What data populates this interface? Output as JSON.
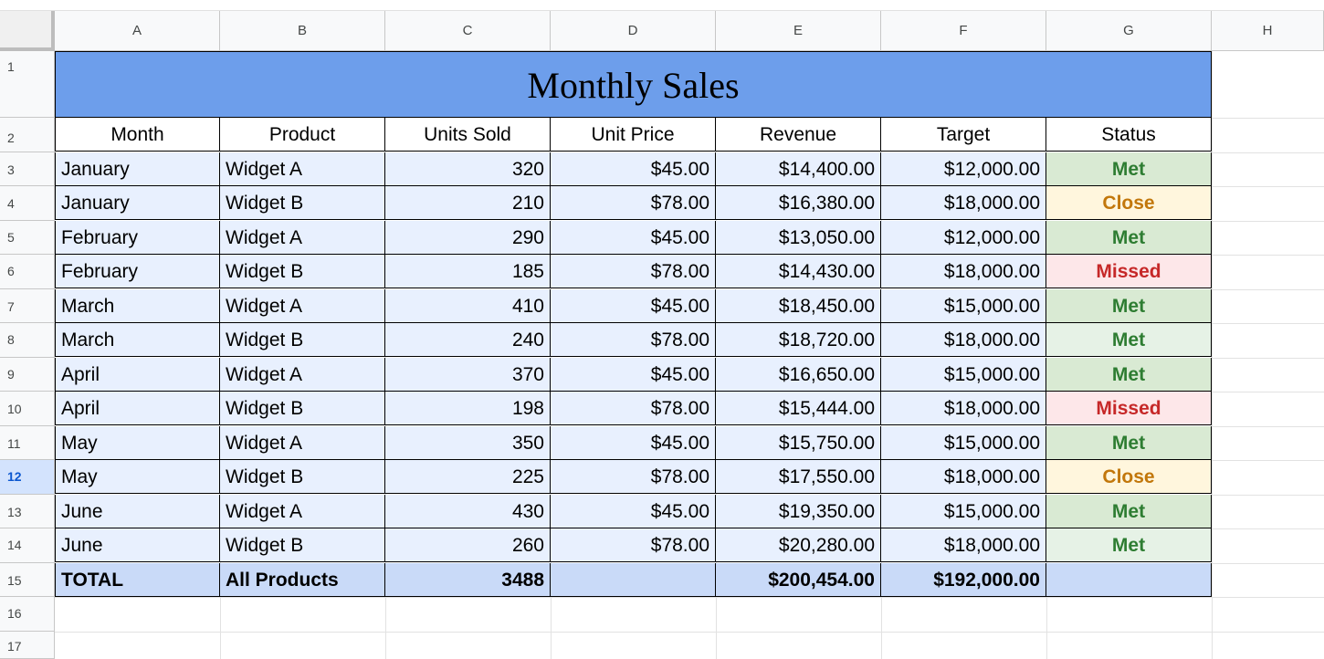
{
  "columns": [
    "A",
    "B",
    "C",
    "D",
    "E",
    "F",
    "G",
    "H"
  ],
  "rows": [
    "1",
    "2",
    "3",
    "4",
    "5",
    "6",
    "7",
    "8",
    "9",
    "10",
    "11",
    "12",
    "13",
    "14",
    "15",
    "16",
    "17"
  ],
  "selected_row": "12",
  "title": "Monthly Sales",
  "headers": [
    "Month",
    "Product",
    "Units Sold",
    "Unit Price",
    "Revenue",
    "Target",
    "Status"
  ],
  "data_rows": [
    {
      "month": "January",
      "product": "Widget A",
      "units": "320",
      "price": "$45.00",
      "revenue": "$14,400.00",
      "target": "$12,000.00",
      "status": "Met"
    },
    {
      "month": "January",
      "product": "Widget B",
      "units": "210",
      "price": "$78.00",
      "revenue": "$16,380.00",
      "target": "$18,000.00",
      "status": "Close"
    },
    {
      "month": "February",
      "product": "Widget A",
      "units": "290",
      "price": "$45.00",
      "revenue": "$13,050.00",
      "target": "$12,000.00",
      "status": "Met"
    },
    {
      "month": "February",
      "product": "Widget B",
      "units": "185",
      "price": "$78.00",
      "revenue": "$14,430.00",
      "target": "$18,000.00",
      "status": "Missed"
    },
    {
      "month": "March",
      "product": "Widget A",
      "units": "410",
      "price": "$45.00",
      "revenue": "$18,450.00",
      "target": "$15,000.00",
      "status": "Met"
    },
    {
      "month": "March",
      "product": "Widget B",
      "units": "240",
      "price": "$78.00",
      "revenue": "$18,720.00",
      "target": "$18,000.00",
      "status": "Met"
    },
    {
      "month": "April",
      "product": "Widget A",
      "units": "370",
      "price": "$45.00",
      "revenue": "$16,650.00",
      "target": "$15,000.00",
      "status": "Met"
    },
    {
      "month": "April",
      "product": "Widget B",
      "units": "198",
      "price": "$78.00",
      "revenue": "$15,444.00",
      "target": "$18,000.00",
      "status": "Missed"
    },
    {
      "month": "May",
      "product": "Widget A",
      "units": "350",
      "price": "$45.00",
      "revenue": "$15,750.00",
      "target": "$15,000.00",
      "status": "Met"
    },
    {
      "month": "May",
      "product": "Widget B",
      "units": "225",
      "price": "$78.00",
      "revenue": "$17,550.00",
      "target": "$18,000.00",
      "status": "Close"
    },
    {
      "month": "June",
      "product": "Widget A",
      "units": "430",
      "price": "$45.00",
      "revenue": "$19,350.00",
      "target": "$15,000.00",
      "status": "Met"
    },
    {
      "month": "June",
      "product": "Widget B",
      "units": "260",
      "price": "$78.00",
      "revenue": "$20,280.00",
      "target": "$18,000.00",
      "status": "Met"
    }
  ],
  "total": {
    "month": "TOTAL",
    "product": "All Products",
    "units": "3488",
    "price": "",
    "revenue": "$200,454.00",
    "target": "$192,000.00",
    "status": ""
  },
  "colors": {
    "title_bg": "#6d9eeb",
    "band": "#e8f0fe",
    "total_bg": "#c9daf8",
    "met": "#2e7d32",
    "close": "#c2770b",
    "missed": "#c62828"
  }
}
